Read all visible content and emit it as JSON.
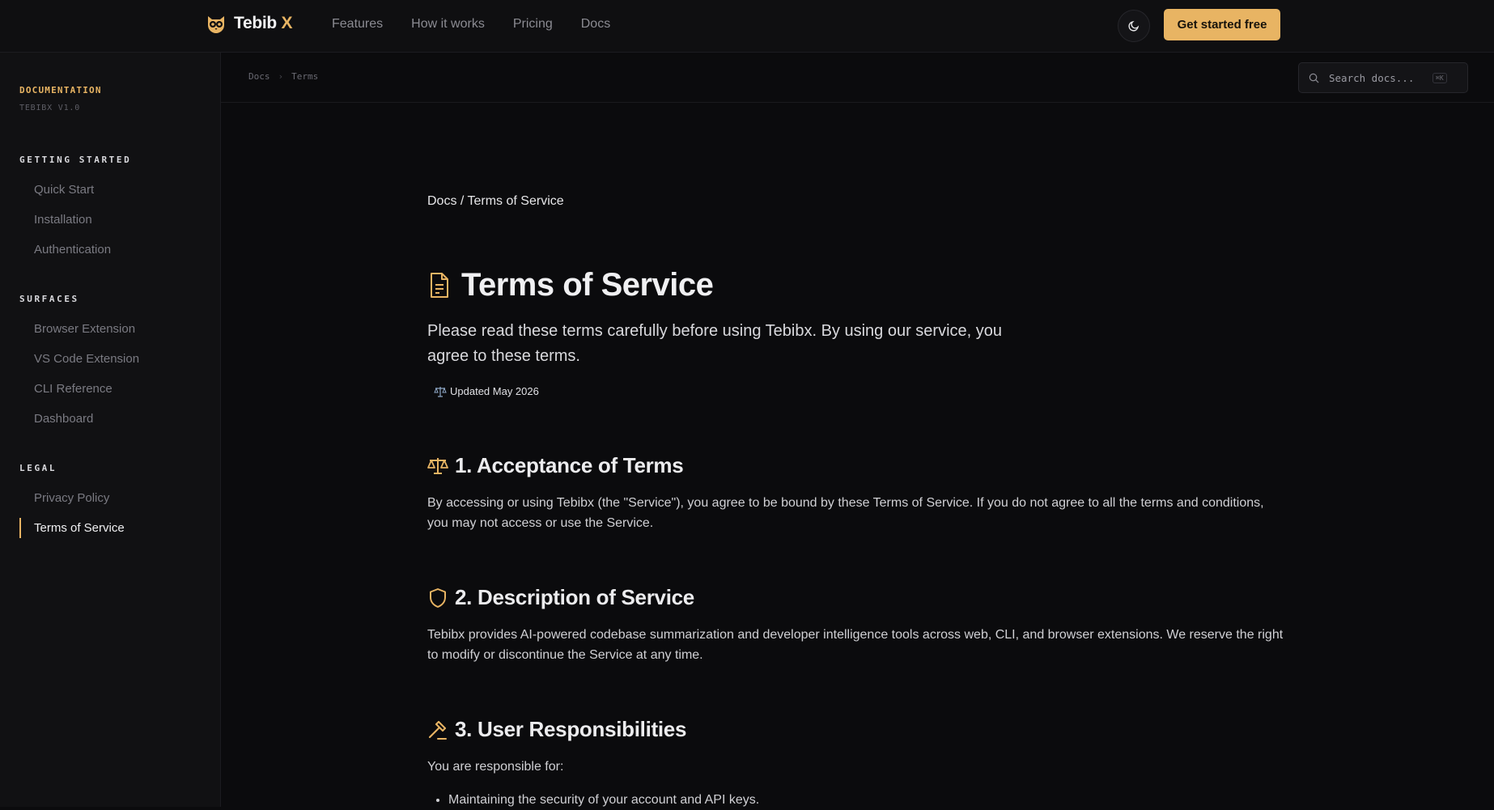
{
  "brand": {
    "name": "Tebib",
    "name_accent": "X",
    "accent_color": "#e8b463"
  },
  "nav": [
    "Features",
    "How it works",
    "Pricing",
    "Docs"
  ],
  "header": {
    "cta_label": "Get started free",
    "theme_icon": "moon-icon"
  },
  "sidebar": {
    "label": "DOCUMENTATION",
    "version": "TEBIBX V1.0",
    "groups": [
      {
        "title": "GETTING STARTED",
        "items": [
          "Quick Start",
          "Installation",
          "Authentication"
        ]
      },
      {
        "title": "SURFACES",
        "items": [
          "Browser Extension",
          "VS Code Extension",
          "CLI Reference",
          "Dashboard"
        ]
      },
      {
        "title": "LEGAL",
        "items": [
          "Privacy Policy",
          "Terms of Service"
        ],
        "active": "Terms of Service"
      }
    ]
  },
  "breadcrumb": {
    "items": [
      "Docs",
      "Terms"
    ]
  },
  "search": {
    "placeholder": "Search docs...",
    "shortcut": "⌘K"
  },
  "page": {
    "path": "Docs / Terms of Service",
    "title": "Terms of Service",
    "lead": "Please read these terms carefully before using Tebibx. By using our service, you agree to these terms.",
    "updated": "Updated May 2026",
    "sections": [
      {
        "icon": "scale-icon",
        "title": "1. Acceptance of Terms",
        "body": "By accessing or using Tebibx (the \"Service\"), you agree to be bound by these Terms of Service. If you do not agree to all the terms and conditions, you may not access or use the Service."
      },
      {
        "icon": "shield-icon",
        "title": "2. Description of Service",
        "body": "Tebibx provides AI-powered codebase summarization and developer intelligence tools across web, CLI, and browser extensions. We reserve the right to modify or discontinue the Service at any time."
      },
      {
        "icon": "gavel-icon",
        "title": "3. User Responsibilities",
        "body": "You are responsible for:",
        "bullets": [
          "Maintaining the security of your account and API keys."
        ]
      }
    ]
  }
}
